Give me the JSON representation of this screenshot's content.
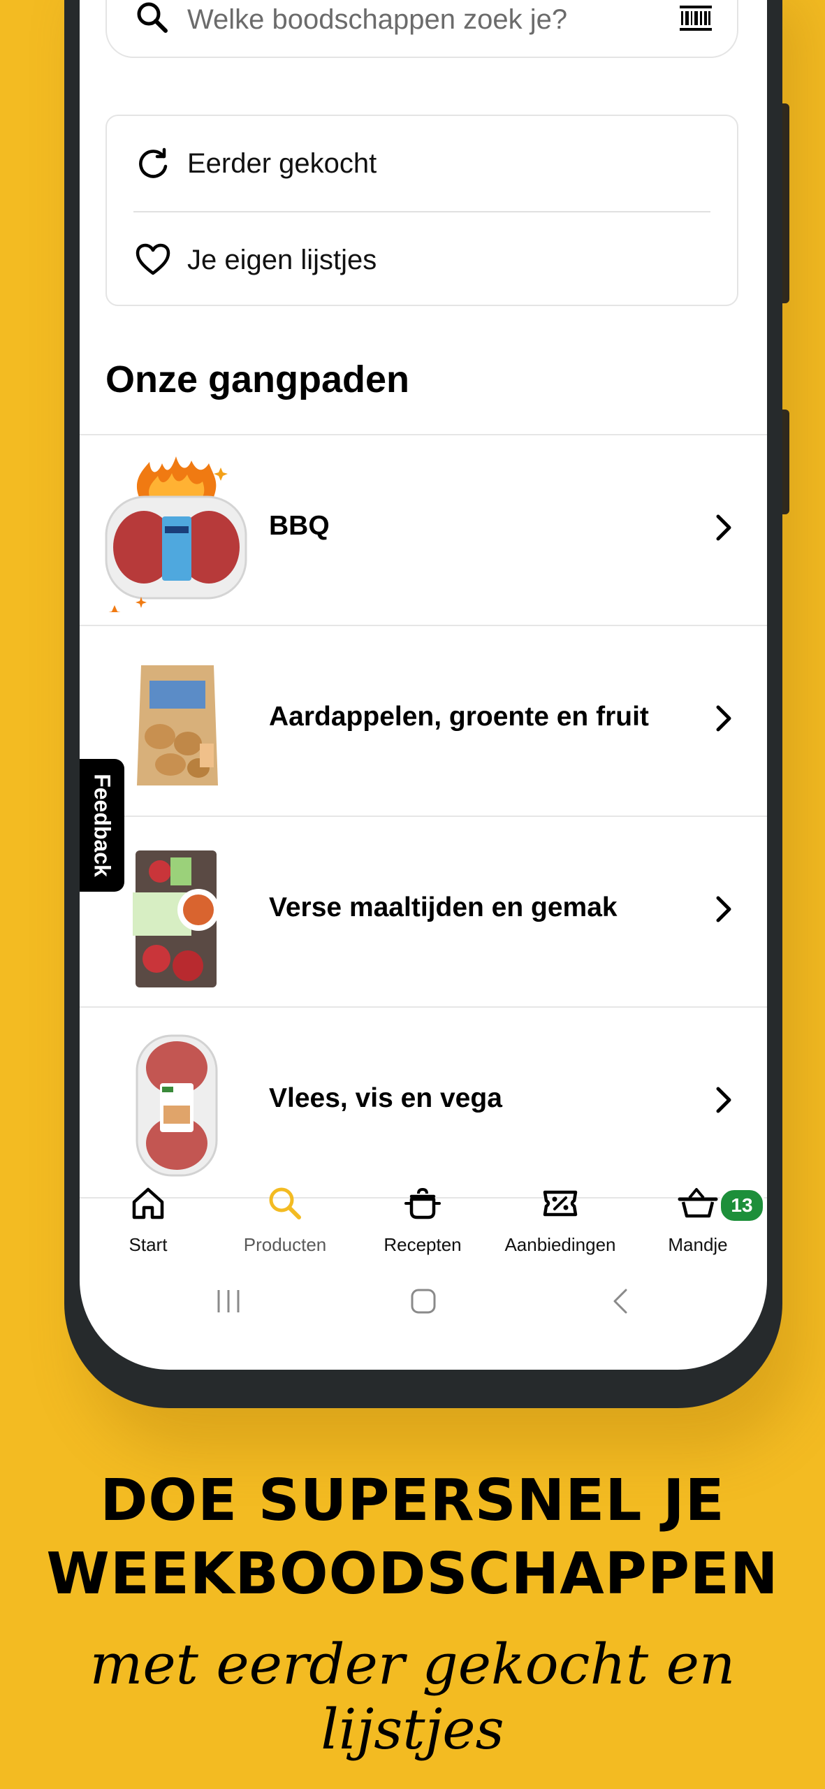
{
  "search": {
    "placeholder": "Welke boodschappen zoek je?"
  },
  "quick_links": [
    {
      "label": "Eerder gekocht",
      "icon": "refresh-icon"
    },
    {
      "label": "Je eigen lijstjes",
      "icon": "heart-icon"
    }
  ],
  "section_title": "Onze gangpaden",
  "aisles": [
    {
      "label": "BBQ"
    },
    {
      "label": "Aardappelen, groente en fruit"
    },
    {
      "label": "Verse maaltijden en gemak"
    },
    {
      "label": "Vlees, vis en vega"
    }
  ],
  "feedback_label": "Feedback",
  "tabs": [
    {
      "label": "Start",
      "icon": "home-icon"
    },
    {
      "label": "Producten",
      "icon": "search-icon",
      "active": true
    },
    {
      "label": "Recepten",
      "icon": "pot-icon"
    },
    {
      "label": "Aanbiedingen",
      "icon": "discount-ticket-icon"
    },
    {
      "label": "Mandje",
      "icon": "basket-icon",
      "badge": "13"
    }
  ],
  "promo": {
    "line1": "DOE SUPERSNEL JE",
    "line2": "WEEKBOODSCHAPPEN",
    "line3": "met eerder gekocht en lijstjes"
  },
  "colors": {
    "background": "#F3BB22",
    "active_tab": "#F3BB22",
    "badge": "#1d8f3a"
  }
}
